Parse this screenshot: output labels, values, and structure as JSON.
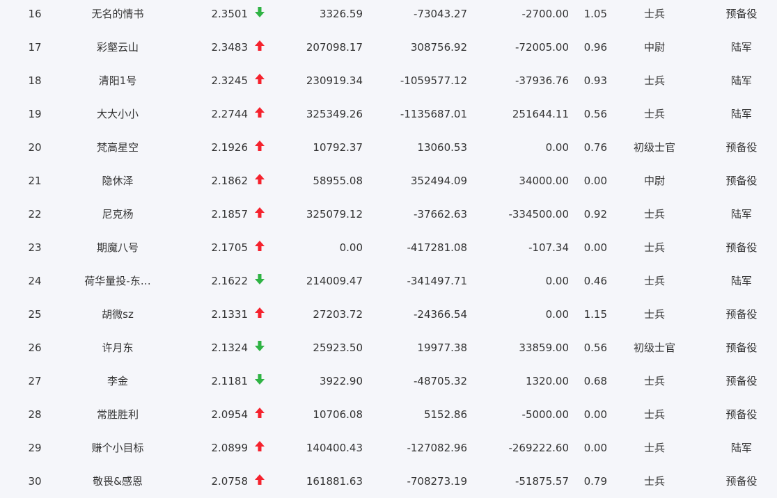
{
  "colors": {
    "up": "#f5222d",
    "down": "#2fb344",
    "text": "#333333",
    "background": "#f5f6fa"
  },
  "rows": [
    {
      "rank": "16",
      "name": "无名的情书",
      "score": "2.3501",
      "trend": "down",
      "v1": "3326.59",
      "v2": "-73043.27",
      "v3": "-2700.00",
      "ratio": "1.05",
      "level": "士兵",
      "type": "预备役"
    },
    {
      "rank": "17",
      "name": "彩壑云山",
      "score": "2.3483",
      "trend": "up",
      "v1": "207098.17",
      "v2": "308756.92",
      "v3": "-72005.00",
      "ratio": "0.96",
      "level": "中尉",
      "type": "陆军"
    },
    {
      "rank": "18",
      "name": "清阳1号",
      "score": "2.3245",
      "trend": "up",
      "v1": "230919.34",
      "v2": "-1059577.12",
      "v3": "-37936.76",
      "ratio": "0.93",
      "level": "士兵",
      "type": "陆军"
    },
    {
      "rank": "19",
      "name": "大大小小",
      "score": "2.2744",
      "trend": "up",
      "v1": "325349.26",
      "v2": "-1135687.01",
      "v3": "251644.11",
      "ratio": "0.56",
      "level": "士兵",
      "type": "陆军"
    },
    {
      "rank": "20",
      "name": "梵高星空",
      "score": "2.1926",
      "trend": "up",
      "v1": "10792.37",
      "v2": "13060.53",
      "v3": "0.00",
      "ratio": "0.76",
      "level": "初级士官",
      "type": "预备役"
    },
    {
      "rank": "21",
      "name": "隐休泽",
      "score": "2.1862",
      "trend": "up",
      "v1": "58955.08",
      "v2": "352494.09",
      "v3": "34000.00",
      "ratio": "0.00",
      "level": "中尉",
      "type": "预备役"
    },
    {
      "rank": "22",
      "name": "尼克杨",
      "score": "2.1857",
      "trend": "up",
      "v1": "325079.12",
      "v2": "-37662.63",
      "v3": "-334500.00",
      "ratio": "0.92",
      "level": "士兵",
      "type": "陆军"
    },
    {
      "rank": "23",
      "name": "期魔八号",
      "score": "2.1705",
      "trend": "up",
      "v1": "0.00",
      "v2": "-417281.08",
      "v3": "-107.34",
      "ratio": "0.00",
      "level": "士兵",
      "type": "预备役"
    },
    {
      "rank": "24",
      "name": "荷华量投-东…",
      "score": "2.1622",
      "trend": "down",
      "v1": "214009.47",
      "v2": "-341497.71",
      "v3": "0.00",
      "ratio": "0.46",
      "level": "士兵",
      "type": "陆军"
    },
    {
      "rank": "25",
      "name": "胡微sz",
      "score": "2.1331",
      "trend": "up",
      "v1": "27203.72",
      "v2": "-24366.54",
      "v3": "0.00",
      "ratio": "1.15",
      "level": "士兵",
      "type": "预备役"
    },
    {
      "rank": "26",
      "name": "许月东",
      "score": "2.1324",
      "trend": "down",
      "v1": "25923.50",
      "v2": "19977.38",
      "v3": "33859.00",
      "ratio": "0.56",
      "level": "初级士官",
      "type": "预备役"
    },
    {
      "rank": "27",
      "name": "李金",
      "score": "2.1181",
      "trend": "down",
      "v1": "3922.90",
      "v2": "-48705.32",
      "v3": "1320.00",
      "ratio": "0.68",
      "level": "士兵",
      "type": "预备役"
    },
    {
      "rank": "28",
      "name": "常胜胜利",
      "score": "2.0954",
      "trend": "up",
      "v1": "10706.08",
      "v2": "5152.86",
      "v3": "-5000.00",
      "ratio": "0.00",
      "level": "士兵",
      "type": "预备役"
    },
    {
      "rank": "29",
      "name": "赚个小目标",
      "score": "2.0899",
      "trend": "up",
      "v1": "140400.43",
      "v2": "-127082.96",
      "v3": "-269222.60",
      "ratio": "0.00",
      "level": "士兵",
      "type": "陆军"
    },
    {
      "rank": "30",
      "name": "敬畏&感恩",
      "score": "2.0758",
      "trend": "up",
      "v1": "161881.63",
      "v2": "-708273.19",
      "v3": "-51875.57",
      "ratio": "0.79",
      "level": "士兵",
      "type": "预备役"
    }
  ]
}
